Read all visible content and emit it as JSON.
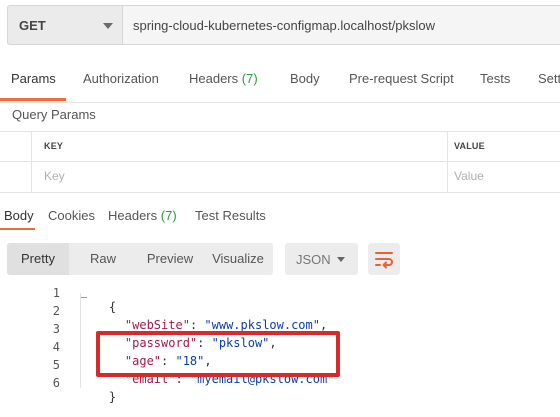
{
  "request": {
    "method": "GET",
    "url": "spring-cloud-kubernetes-configmap.localhost/pkslow"
  },
  "request_tabs": [
    {
      "label": "Params",
      "count": ""
    },
    {
      "label": "Authorization",
      "count": ""
    },
    {
      "label": "Headers",
      "count": "(7)"
    },
    {
      "label": "Body",
      "count": ""
    },
    {
      "label": "Pre-request Script",
      "count": ""
    },
    {
      "label": "Tests",
      "count": ""
    },
    {
      "label": "Sett",
      "count": ""
    }
  ],
  "query_params": {
    "title": "Query Params",
    "key_header": "KEY",
    "value_header": "VALUE",
    "key_placeholder": "Key",
    "value_placeholder": "Value"
  },
  "response_tabs": [
    {
      "label": "Body",
      "count": ""
    },
    {
      "label": "Cookies",
      "count": ""
    },
    {
      "label": "Headers",
      "count": "(7)"
    },
    {
      "label": "Test Results",
      "count": ""
    }
  ],
  "view_modes": [
    "Pretty",
    "Raw",
    "Preview",
    "Visualize"
  ],
  "format": "JSON",
  "icons": {
    "method_dropdown": "chevron-down-icon",
    "format_dropdown": "chevron-down-icon",
    "wrap": "wrap-lines-icon"
  },
  "colors": {
    "accent": "#f26b3a",
    "count": "#2b9a3f",
    "json_key": "#a11a4e",
    "json_string": "#0b3ea8",
    "highlight_box": "#d82a2a"
  },
  "code": {
    "line_numbers": [
      "1",
      "2",
      "3",
      "4",
      "5",
      "6"
    ],
    "open_brace": "{",
    "close_brace": "}",
    "entries": [
      {
        "key": "\"webSite\"",
        "value": "\"www.pkslow.com\"",
        "suffix": ","
      },
      {
        "key": "\"password\"",
        "value": "\"pkslow\"",
        "suffix": ","
      },
      {
        "key": "\"age\"",
        "value": "\"18\"",
        "suffix": ","
      },
      {
        "key": "\"email\"",
        "value": "\"myemail@pkslow.com\"",
        "suffix": ""
      }
    ]
  }
}
